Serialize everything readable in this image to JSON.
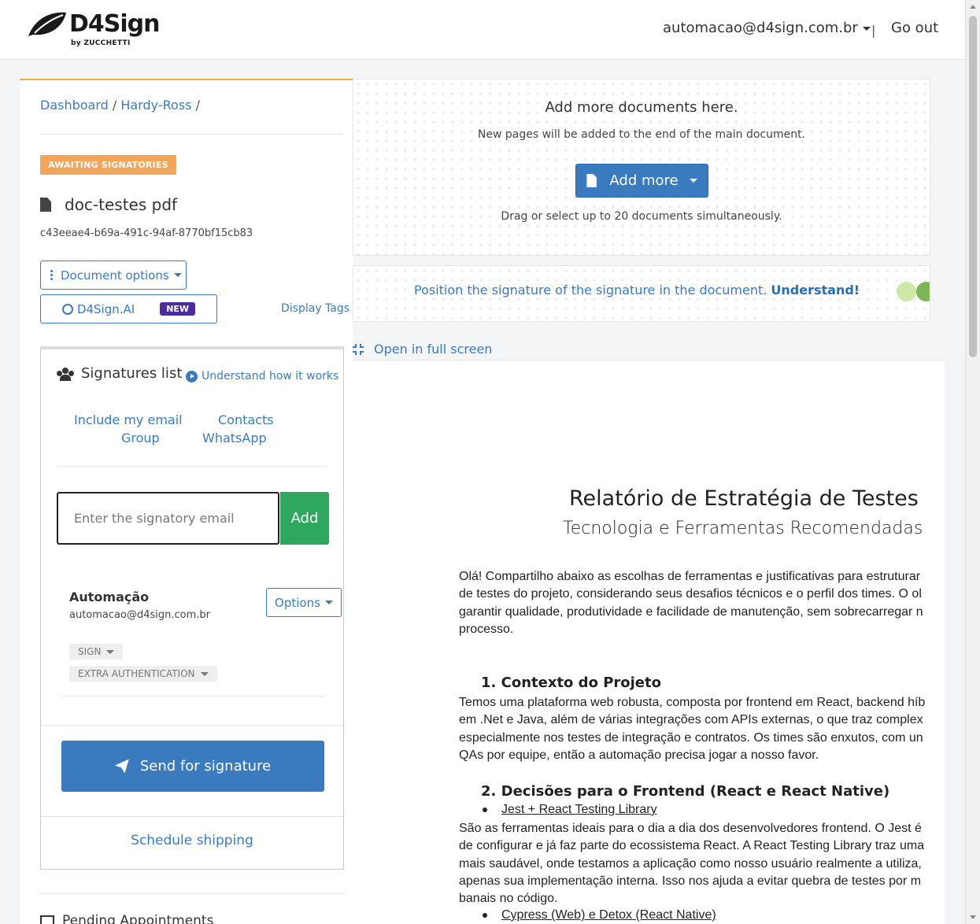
{
  "header": {
    "logo_text": "D4Sign",
    "logo_sub": "by ZUCCHETTI",
    "user_email": "automacao@d4sign.com.br",
    "separator": "|",
    "logout_label": "Go out"
  },
  "breadcrumb": {
    "items": [
      "Dashboard",
      "Hardy-Ross"
    ],
    "separator": "/"
  },
  "document": {
    "status": "AWAITING SIGNATORIES",
    "name": "doc-testes pdf",
    "hash": "c43eeae4-b69a-491c-94af-8770bf15cb83",
    "options_label": "Document options",
    "ai_label": "D4Sign.AI",
    "ai_badge": "NEW",
    "display_tags_label": "Display Tags"
  },
  "signatures": {
    "title": "Signatures list",
    "understand_label": "Understand how it works",
    "quick_links": [
      "Include my email",
      "Contacts",
      "Group",
      "WhatsApp"
    ],
    "email_placeholder": "Enter the signatory email",
    "add_label": "Add",
    "signers": [
      {
        "name": "Automação",
        "email": "automacao@d4sign.com.br",
        "options_label": "Options",
        "action": "SIGN",
        "auth": "EXTRA AUTHENTICATION"
      }
    ],
    "send_label": "Send for signature",
    "schedule_label": "Schedule shipping"
  },
  "pending": {
    "title": "Pending Appointments"
  },
  "upload": {
    "title": "Add more documents here.",
    "subtitle": "New pages will be added to the end of the main document.",
    "button_label": "Add more",
    "hint": "Drag or select up to 20 documents simultaneously."
  },
  "tip": {
    "text": "Position the signature of the signature in the document.",
    "link": "Understand!"
  },
  "fullscreen_label": "Open in full screen",
  "pdf": {
    "title": "Relatório de Estratégia de Testes",
    "subtitle": "Tecnologia e Ferramentas Recomendadas",
    "intro": [
      "Olá! Compartilho abaixo as escolhas de ferramentas e justificativas para estruturar",
      "de testes do projeto, considerando seus desafios técnicos e o perfil dos times. O ol",
      "garantir qualidade, produtividade e facilidade de manutenção, sem sobrecarregar n",
      "processo."
    ],
    "section1_title": "1.  Contexto do Projeto",
    "section1": [
      "Temos uma plataforma web robusta, composta por frontend em React, backend híb",
      "em .Net e Java, além de várias integrações com APIs externas, o que traz complex",
      "especialmente nos testes de integração e contratos. Os times são enxutos, com un",
      "QAs por equipe, então a automação precisa jogar a nosso favor."
    ],
    "section2_title": "2.  Decisões para o Frontend (React e React Native)",
    "bullet1": "Jest + React Testing Library",
    "section2": [
      "São as ferramentas ideais para o dia a dia dos desenvolvedores frontend. O Jest é",
      "de configurar e já faz parte do ecossistema React. A React Testing Library traz uma",
      "mais saudável, onde testamos a aplicação como nosso usuário realmente a utiliza,",
      "apenas sua implementação interna. Isso nos ajuda a evitar quebra de testes por m",
      "banais no código."
    ],
    "bullet2": "Cypress (Web) e Detox (React Native)"
  },
  "colors": {
    "primary": "#3a7bbf",
    "success": "#2fa85f",
    "warning": "#f3a65a",
    "ai_badge": "#4a2ca0"
  },
  "icons": [
    "logo-leaf-icon",
    "caret-down-icon",
    "file-icon",
    "vertical-dots-icon",
    "globe-icon",
    "users-icon",
    "play-circle-icon",
    "paper-plane-icon",
    "list-icon",
    "compress-icon"
  ]
}
